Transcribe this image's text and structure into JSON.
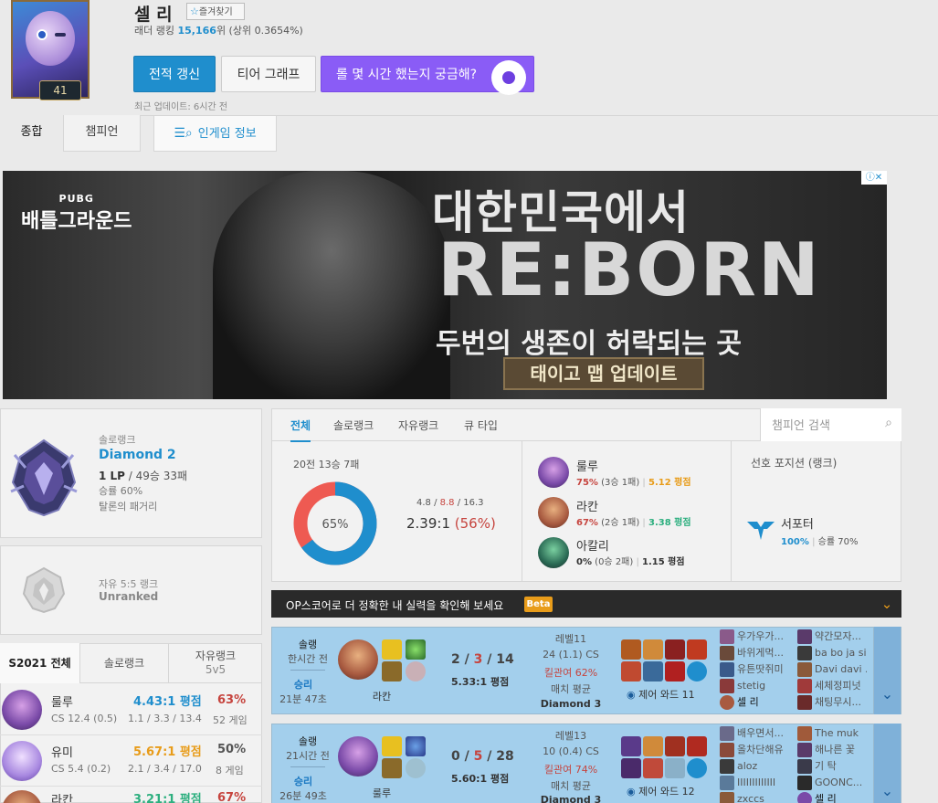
{
  "profile": {
    "name": "셀 리",
    "level": "41",
    "favorite_label": "즐겨찾기",
    "ladder_prefix": "래더 랭킹",
    "ladder_rank": "15,166",
    "ladder_suffix": "위 (상위 0.3654%)",
    "updated": "최근 업데이트: 6시간 전"
  },
  "buttons": {
    "renew": "전적 갱신",
    "tier_graph": "티어 그래프",
    "role": "롤 몇 시간 했는지 궁금해?"
  },
  "tabs": {
    "summary": "종합",
    "champion": "챔피언",
    "ingame": "인게임 정보"
  },
  "ad": {
    "brand_small": "PUBG",
    "brand": "배틀그라운드",
    "line1": "대한민국에서",
    "line2": "RE:BORN",
    "line3": "두번의 생존이 허락되는 곳",
    "cta": "태이고 맵 업데이트",
    "info": "ⓘ✕"
  },
  "solo_rank": {
    "label": "솔로랭크",
    "tier": "Diamond 2",
    "lp": "1 LP",
    "record": "/ 49승 33패",
    "winrate": "승률 60%",
    "league": "탈론의 패거리"
  },
  "flex_rank": {
    "label": "자유 5:5 랭크",
    "tier": "Unranked"
  },
  "season": {
    "tabs": [
      "S2021 전체",
      "솔로랭크",
      "자유랭크",
      "5v5"
    ],
    "champions": [
      {
        "name": "룰루",
        "cs": "CS 12.4 (0.5)",
        "kda": "4.43:1 평점",
        "kda_detail": "1.1 / 3.3 / 13.4",
        "winrate": "63%",
        "games": "52 게임",
        "color": "#1f8ecd"
      },
      {
        "name": "유미",
        "cs": "CS 5.4 (0.2)",
        "kda": "5.67:1 평점",
        "kda_detail": "2.1 / 3.4 / 17.0",
        "winrate": "50%",
        "games": "8 게임",
        "color": "#e89c1a"
      },
      {
        "name": "라칸",
        "cs": "",
        "kda": "3.21:1 평점",
        "kda_detail": "",
        "winrate": "67%",
        "games": "",
        "color": "#2daf7f"
      }
    ]
  },
  "summary": {
    "tabs": [
      "전체",
      "솔로랭크",
      "자유랭크",
      "큐 타입"
    ],
    "search_placeholder": "챔피언 검색",
    "record": "20전 13승 7패",
    "winrate_pct": 65,
    "winrate_label": "65%",
    "kda_k": "4.8",
    "kda_sep1": " / ",
    "kda_d": "8.8",
    "kda_sep2": " / ",
    "kda_a": "16.3",
    "kda_ratio": "2.39:1",
    "kda_pct": "(56%)",
    "most": [
      {
        "name": "룰루",
        "wr": "75%",
        "rec": "(3승 1패)",
        "kda": "5.12 평점",
        "kda_color": "#e89c1a"
      },
      {
        "name": "라칸",
        "wr": "67%",
        "rec": "(2승 1패)",
        "kda": "3.38 평점",
        "kda_color": "#2daf7f"
      },
      {
        "name": "아칼리",
        "wr": "0%",
        "rec": "(0승 2패)",
        "kda": "1.15 평점",
        "kda_color": "#333333"
      }
    ],
    "position_title": "선호 포지션 (랭크)",
    "position_name": "서포터",
    "position_pct": "100%",
    "position_wr": "승률 70%"
  },
  "op_banner": {
    "text": "OP스코어로 더 정확한 내 실력을 확인해 보세요",
    "badge": "Beta"
  },
  "games": [
    {
      "type": "솔랭",
      "time": "한시간 전",
      "result": "승리",
      "duration": "21분 47초",
      "champion": "라칸",
      "kda_k": "2",
      "kda_d": "3",
      "kda_a": "14",
      "kda_ratio": "5.33:1 평점",
      "level": "레벨11",
      "cs": "24 (1.1) CS",
      "kill_part": "킬관여 62%",
      "avg": "매치 평균",
      "avg_tier": "Diamond 3",
      "ward": "제어 와드 11",
      "team1": [
        "우가우가...",
        "바위게먹...",
        "유튼땃쥐미",
        "stetig",
        "셀 리"
      ],
      "team2": [
        "약간모자...",
        "ba bo ja sik",
        "Davi davi ...",
        "세체정피넛",
        "채팅무시..."
      ]
    },
    {
      "type": "솔랭",
      "time": "21시간 전",
      "result": "승리",
      "duration": "26분 49초",
      "champion": "룰루",
      "kda_k": "0",
      "kda_d": "5",
      "kda_a": "28",
      "kda_ratio": "5.60:1 평점",
      "level": "레벨13",
      "cs": "10 (0.4) CS",
      "kill_part": "킬관여 74%",
      "avg": "매치 평균",
      "avg_tier": "Diamond 3",
      "ward": "제어 와드 12",
      "team1": [
        "배우면서...",
        "올차단해유",
        "aloz",
        "IIIIIIIIIIIII",
        "zxccs"
      ],
      "team2": [
        "The muk",
        "해나른 꽃",
        "기 탁",
        "GOONC...",
        "셀 리"
      ]
    }
  ],
  "colors": {
    "accent": "#1f8ecd",
    "loss": "#c6443e",
    "win_bg": "#a3cfec",
    "role_button": "#8a5cf6"
  }
}
